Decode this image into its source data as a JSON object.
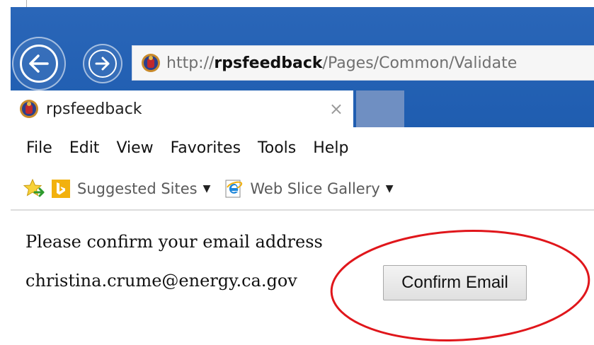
{
  "browser": {
    "address": {
      "prefix": "http://",
      "domain": "rpsfeedback",
      "path": "/Pages/Common/Validate"
    },
    "tab": {
      "title": "rpsfeedback",
      "close_glyph": "×"
    },
    "menu": [
      "File",
      "Edit",
      "View",
      "Favorites",
      "Tools",
      "Help"
    ],
    "favorites": {
      "suggested_sites": "Suggested Sites",
      "web_slice_gallery": "Web Slice Gallery"
    },
    "colors": {
      "chrome_blue": "#2a66b8",
      "new_tab": "#6f8fc2",
      "bing": "#f2b10e"
    }
  },
  "page": {
    "prompt": "Please confirm your email address",
    "email": "christina.crume@energy.ca.gov",
    "confirm_button": "Confirm Email"
  },
  "annotation": {
    "shape": "ellipse",
    "color": "#e0161b"
  },
  "icons": [
    "back-arrow-icon",
    "forward-arrow-icon",
    "site-favicon-icon",
    "favorites-star-icon",
    "bing-icon",
    "ie-icon",
    "dropdown-caret-icon"
  ]
}
